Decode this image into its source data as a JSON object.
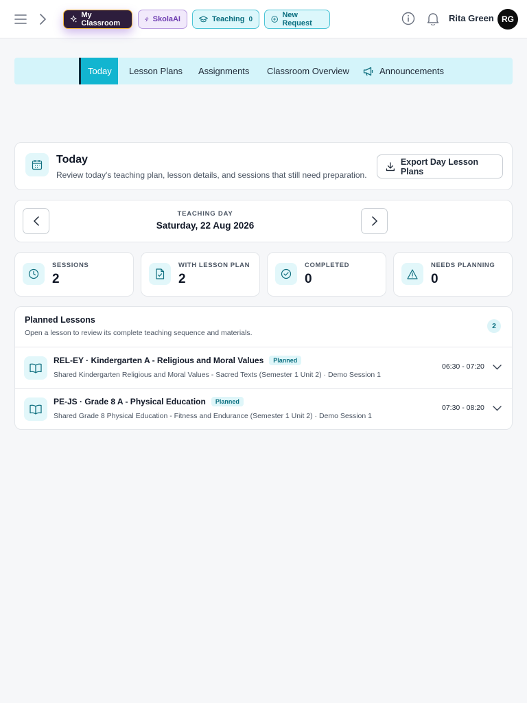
{
  "header": {
    "pills": [
      {
        "label": "My Classroom",
        "icon": "sparkle-icon"
      },
      {
        "label": "SkolaAI",
        "icon": "bolt-icon"
      },
      {
        "label": "Teaching",
        "count": "0",
        "icon": "cap-icon"
      },
      {
        "label": "New Request",
        "icon": "plus-circle-icon"
      }
    ],
    "user_name": "Rita Green",
    "avatar_initials": "RG"
  },
  "tabs": [
    {
      "label": "Today",
      "active": true
    },
    {
      "label": "Lesson Plans"
    },
    {
      "label": "Assignments"
    },
    {
      "label": "Classroom Overview"
    },
    {
      "label": "Announcements",
      "icon": "megaphone-icon"
    }
  ],
  "today": {
    "title": "Today",
    "description": "Review today's teaching plan, lesson details, and sessions that still need preparation.",
    "export_label": "Export Day Lesson Plans"
  },
  "day": {
    "label": "TEACHING DAY",
    "date": "Saturday, 22 Aug 2026"
  },
  "stats": [
    {
      "label": "SESSIONS",
      "value": "2",
      "icon": "clock-icon"
    },
    {
      "label": "WITH LESSON PLAN",
      "value": "2",
      "icon": "file-check-icon"
    },
    {
      "label": "COMPLETED",
      "value": "0",
      "icon": "check-circle-icon"
    },
    {
      "label": "NEEDS PLANNING",
      "value": "0",
      "icon": "warning-icon"
    }
  ],
  "lessons": {
    "title": "Planned Lessons",
    "description": "Open a lesson to review its complete teaching sequence and materials.",
    "count": "2",
    "items": [
      {
        "title": "REL-EY · Kindergarten A - Religious and Moral Values",
        "status": "Planned",
        "subtitle": "Shared Kindergarten Religious and Moral Values - Sacred Texts (Semester 1 Unit 2) · Demo Session 1",
        "time": "06:30 - 07:20"
      },
      {
        "title": "PE-JS · Grade 8 A - Physical Education",
        "status": "Planned",
        "subtitle": "Shared Grade 8 Physical Education - Fitness and Endurance (Semester 1 Unit 2) · Demo Session 1",
        "time": "07:30 - 08:20"
      }
    ]
  },
  "colors": {
    "accent": "#12b5d0",
    "tabbar_bg": "#d4f4fa",
    "icon_stroke": "#0f6f7f",
    "classroom_pill_bg": "#2d1d3c"
  }
}
